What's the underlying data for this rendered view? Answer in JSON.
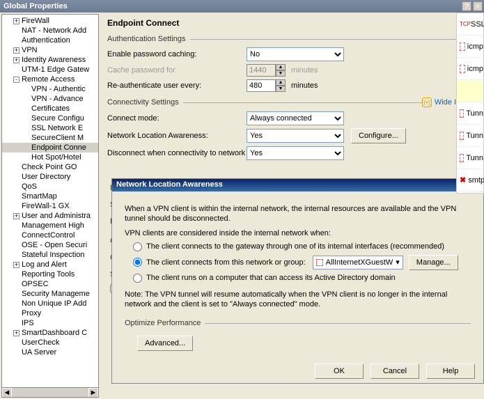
{
  "window": {
    "title": "Global Properties"
  },
  "tree": {
    "items": [
      {
        "label": "FireWall",
        "indent": 1,
        "exp": "+"
      },
      {
        "label": "NAT - Network Add",
        "indent": 1,
        "exp": ""
      },
      {
        "label": "Authentication",
        "indent": 1,
        "exp": ""
      },
      {
        "label": "VPN",
        "indent": 1,
        "exp": "+"
      },
      {
        "label": "Identity Awareness",
        "indent": 1,
        "exp": "+"
      },
      {
        "label": "UTM-1 Edge Gatew",
        "indent": 1,
        "exp": ""
      },
      {
        "label": "Remote Access",
        "indent": 1,
        "exp": "-"
      },
      {
        "label": "VPN - Authentic",
        "indent": 2,
        "exp": ""
      },
      {
        "label": "VPN - Advance",
        "indent": 2,
        "exp": ""
      },
      {
        "label": "Certificates",
        "indent": 2,
        "exp": ""
      },
      {
        "label": "Secure Configu",
        "indent": 2,
        "exp": ""
      },
      {
        "label": "SSL Network E",
        "indent": 2,
        "exp": ""
      },
      {
        "label": "SecureClient M",
        "indent": 2,
        "exp": ""
      },
      {
        "label": "Endpoint Conne",
        "indent": 2,
        "exp": "",
        "selected": true
      },
      {
        "label": "Hot Spot/Hotel",
        "indent": 2,
        "exp": ""
      },
      {
        "label": "Check Point GO",
        "indent": 1,
        "exp": ""
      },
      {
        "label": "User Directory",
        "indent": 1,
        "exp": ""
      },
      {
        "label": "QoS",
        "indent": 1,
        "exp": ""
      },
      {
        "label": "SmartMap",
        "indent": 1,
        "exp": ""
      },
      {
        "label": "FireWall-1 GX",
        "indent": 1,
        "exp": ""
      },
      {
        "label": "User and Administra",
        "indent": 1,
        "exp": "+"
      },
      {
        "label": "Management High ",
        "indent": 1,
        "exp": ""
      },
      {
        "label": "ConnectControl",
        "indent": 1,
        "exp": ""
      },
      {
        "label": "OSE - Open Securi",
        "indent": 1,
        "exp": ""
      },
      {
        "label": "Stateful Inspection",
        "indent": 1,
        "exp": ""
      },
      {
        "label": "Log and Alert",
        "indent": 1,
        "exp": "+"
      },
      {
        "label": "Reporting Tools",
        "indent": 1,
        "exp": ""
      },
      {
        "label": "OPSEC",
        "indent": 1,
        "exp": ""
      },
      {
        "label": "Security Manageme",
        "indent": 1,
        "exp": ""
      },
      {
        "label": "Non Unique IP Add",
        "indent": 1,
        "exp": ""
      },
      {
        "label": "Proxy",
        "indent": 1,
        "exp": ""
      },
      {
        "label": "IPS",
        "indent": 1,
        "exp": ""
      },
      {
        "label": "SmartDashboard C",
        "indent": 1,
        "exp": "+"
      },
      {
        "label": "UserCheck",
        "indent": 1,
        "exp": ""
      },
      {
        "label": "UA Server",
        "indent": 1,
        "exp": ""
      }
    ]
  },
  "page": {
    "heading": "Endpoint Connect",
    "auth_section": "Authentication Settings",
    "enable_caching_label": "Enable password caching:",
    "enable_caching_value": "No",
    "cache_for_label": "Cache password for",
    "cache_for_value": "1440",
    "cache_unit": "minutes",
    "reauth_label": "Re-authenticate user every:",
    "reauth_value": "480",
    "reauth_unit": "minutes",
    "conn_section": "Connectivity Settings",
    "wide_impact": "Wide Impact",
    "connect_mode_label": "Connect mode:",
    "connect_mode_value": "Always connected",
    "nla_label": "Network Location Awareness:",
    "nla_value": "Yes",
    "configure_btn": "Configure...",
    "disconnect_label": "Disconnect when connectivity to network is lost:",
    "disconnect_value": "Yes"
  },
  "nla": {
    "title": "Network Location Awareness",
    "para1": "When a VPN client is within the internal network, the internal resources are available and the VPN tunnel should be disconnected.",
    "para2": "VPN clients are considered inside the internal network when:",
    "opt1": "The client connects to the gateway through one of its internal interfaces (recommended)",
    "opt2": "The client connects from this network or group:",
    "opt2_value": "AllInternetXGuestW",
    "manage_btn": "Manage...",
    "opt3": "The client runs on a computer that can access its Active Directory domain",
    "note": "Note: The VPN tunnel will resume automatically when the VPN client is no longer in the internal network and the client is set to \"Always connected\" mode.",
    "optimize_section": "Optimize Performance",
    "advanced_btn": "Advanced...",
    "ok": "OK",
    "cancel": "Cancel",
    "help": "Help"
  },
  "bg_letters": [
    "D",
    "S",
    "R",
    "C",
    "C",
    "S"
  ],
  "right": {
    "items": [
      {
        "t": "SSL",
        "c": "tcp"
      },
      {
        "t": "icmp",
        "c": "pink"
      },
      {
        "t": "icmp",
        "c": "pink"
      },
      {
        "t": "",
        "c": "hl"
      },
      {
        "t": "Tunn",
        "c": "pink"
      },
      {
        "t": "Tunn",
        "c": "pink"
      },
      {
        "t": "Tunn",
        "c": "pink"
      },
      {
        "t": "smtp",
        "c": "x"
      }
    ]
  }
}
